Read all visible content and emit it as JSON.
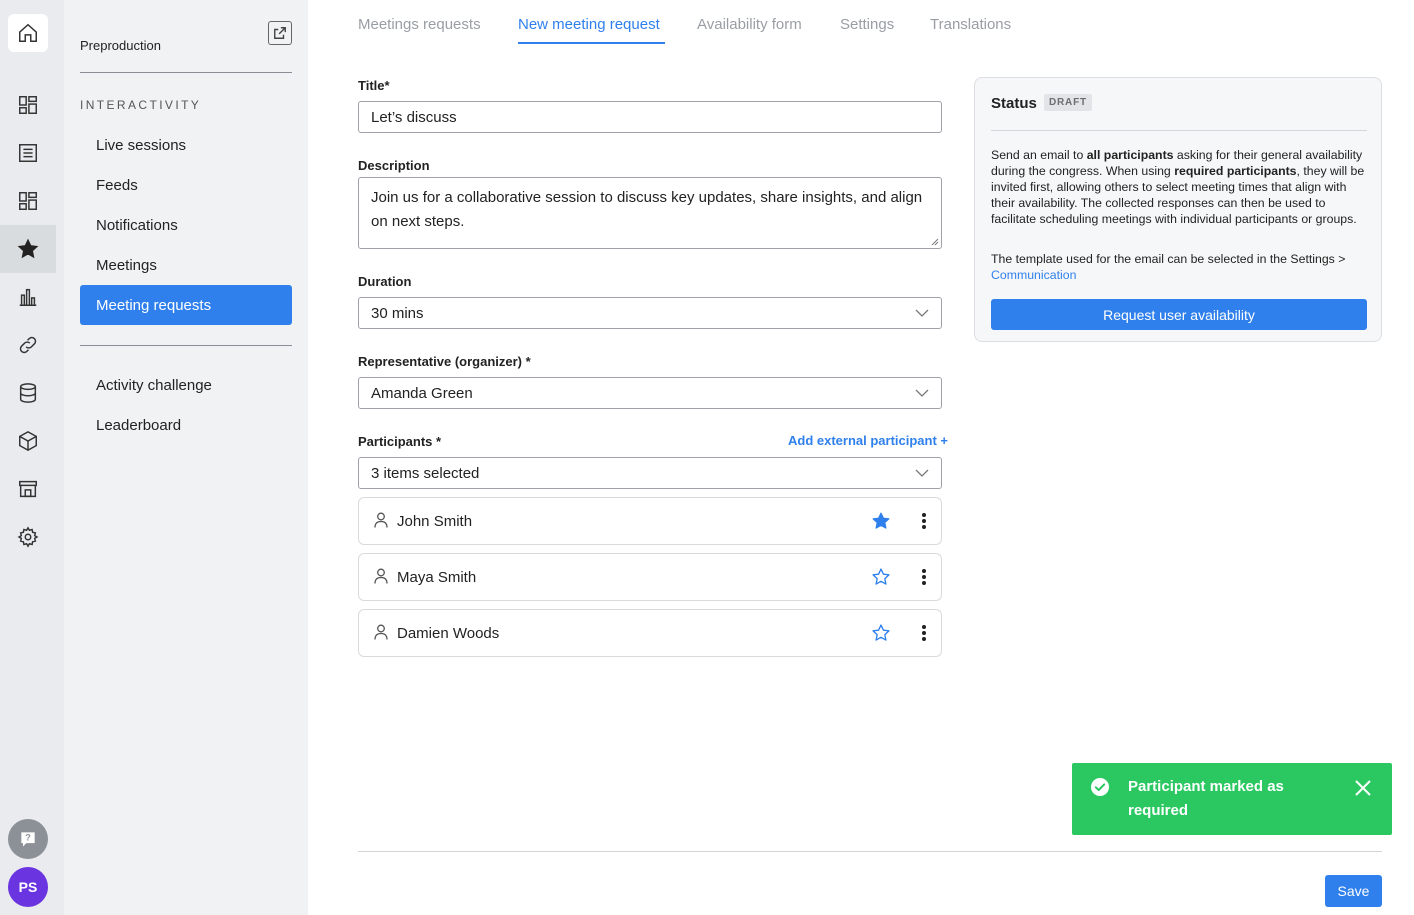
{
  "rail": {
    "icons": [
      "home-icon",
      "dashboard-icon",
      "agenda-icon",
      "layout-icon",
      "star-icon",
      "bar-chart-icon",
      "link-icon",
      "database-icon",
      "cube-icon",
      "store-icon",
      "gear-icon",
      "help-icon"
    ],
    "avatar_initials": "PS",
    "avatar_color": "#6a34e0"
  },
  "sidebar": {
    "project": "Preproduction",
    "section": "INTERACTIVITY",
    "items": [
      {
        "label": "Live sessions"
      },
      {
        "label": "Feeds"
      },
      {
        "label": "Notifications"
      },
      {
        "label": "Meetings"
      },
      {
        "label": "Meeting requests",
        "active": true
      }
    ],
    "extra_items": [
      {
        "label": "Activity challenge"
      },
      {
        "label": "Leaderboard"
      }
    ]
  },
  "tabs": [
    {
      "label": "Meetings requests"
    },
    {
      "label": "New meeting request",
      "active": true
    },
    {
      "label": "Availability form"
    },
    {
      "label": "Settings"
    },
    {
      "label": "Translations"
    }
  ],
  "form": {
    "title_label": "Title*",
    "title_value": "Let’s discuss",
    "description_label": "Description",
    "description_value": "Join us for a collaborative session to discuss key updates, share insights, and align on next steps.",
    "duration_label": "Duration",
    "duration_value": "30 mins",
    "representative_label": "Representative (organizer) *",
    "representative_value": "Amanda Green",
    "participants_label": "Participants *",
    "add_external_label": "Add external participant +",
    "participants_value": "3 items selected",
    "participants": [
      {
        "name": "John Smith",
        "required": true
      },
      {
        "name": "Maya Smith",
        "required": false
      },
      {
        "name": "Damien Woods",
        "required": false
      }
    ]
  },
  "status": {
    "title": "Status",
    "badge": "DRAFT",
    "p1_a": "Send an email to ",
    "p1_b": "all participants",
    "p1_c": " asking for their general availability during the congress. When using ",
    "p1_d": "required participants",
    "p1_e": ", they will be invited first, allowing others to select meeting times that align with their availability. The collected responses can then be used to facilitate scheduling meetings with individual participants or groups.",
    "p2_a": "The template used for the email can be selected in the Settings > ",
    "p2_link": "Communication",
    "button": "Request user availability"
  },
  "toast": {
    "message": "Participant marked as required",
    "color": "#2bc862"
  },
  "footer": {
    "save": "Save"
  },
  "colors": {
    "accent": "#2f80ed"
  }
}
